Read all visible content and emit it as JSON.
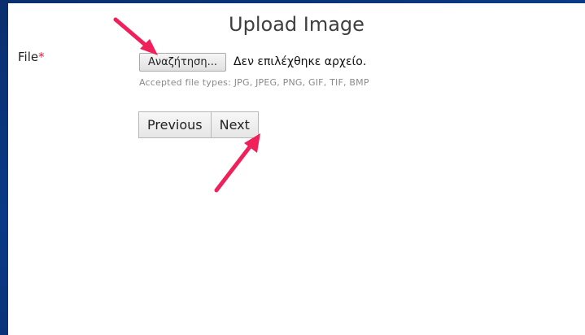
{
  "page": {
    "title": "Upload Image"
  },
  "form": {
    "file_label": "File",
    "required_marker": "*",
    "browse_label": "Αναζήτηση...",
    "file_status": "Δεν επιλέχθηκε αρχείο.",
    "hint": "Accepted file types: JPG, JPEG, PNG, GIF, TIF, BMP"
  },
  "nav": {
    "previous_label": "Previous",
    "next_label": "Next"
  },
  "annotations": {
    "arrow_color": "#f0215a"
  }
}
